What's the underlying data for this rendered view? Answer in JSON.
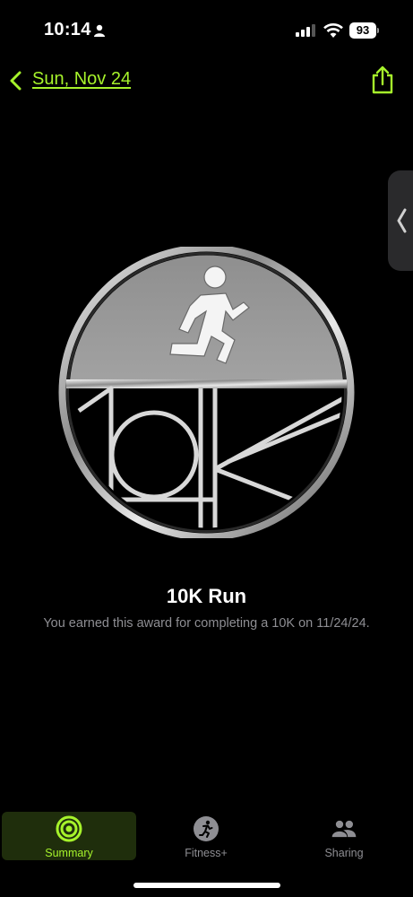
{
  "status_bar": {
    "time": "10:14",
    "battery": "93"
  },
  "nav": {
    "back_label": "Sun, Nov 24"
  },
  "award": {
    "title": "10K Run",
    "description": "You earned this award for completing a 10K on 11/24/24."
  },
  "tabs": [
    {
      "label": "Summary",
      "icon": "activity-rings-icon",
      "selected": true
    },
    {
      "label": "Fitness+",
      "icon": "runner-icon",
      "selected": false
    },
    {
      "label": "Sharing",
      "icon": "people-icon",
      "selected": false
    }
  ],
  "colors": {
    "accent": "#a6f32b",
    "background": "#000000",
    "secondary_text": "#8e8e93"
  }
}
